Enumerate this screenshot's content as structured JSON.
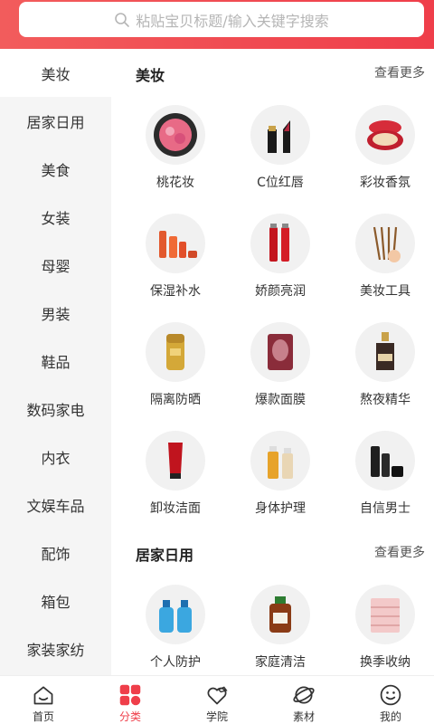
{
  "search": {
    "placeholder": "粘贴宝贝标题/输入关键字搜索"
  },
  "sidebar": {
    "items": [
      {
        "label": "美妆"
      },
      {
        "label": "居家日用"
      },
      {
        "label": "美食"
      },
      {
        "label": "女装"
      },
      {
        "label": "母婴"
      },
      {
        "label": "男装"
      },
      {
        "label": "鞋品"
      },
      {
        "label": "数码家电"
      },
      {
        "label": "内衣"
      },
      {
        "label": "文娱车品"
      },
      {
        "label": "配饰"
      },
      {
        "label": "箱包"
      },
      {
        "label": "家装家纺"
      }
    ]
  },
  "sections": [
    {
      "title": "美妆",
      "more": "查看更多",
      "items": [
        {
          "label": "桃花妆",
          "icon": "compact-powder-icon"
        },
        {
          "label": "C位红唇",
          "icon": "lipstick-icon"
        },
        {
          "label": "彩妆香氛",
          "icon": "cushion-compact-icon"
        },
        {
          "label": "保湿补水",
          "icon": "skincare-set-icon"
        },
        {
          "label": "娇颜亮润",
          "icon": "serum-bottles-icon"
        },
        {
          "label": "美妆工具",
          "icon": "makeup-brushes-icon"
        },
        {
          "label": "隔离防晒",
          "icon": "sunscreen-icon"
        },
        {
          "label": "爆款面膜",
          "icon": "face-mask-icon"
        },
        {
          "label": "熬夜精华",
          "icon": "essence-bottle-icon"
        },
        {
          "label": "卸妆洁面",
          "icon": "cleanser-tube-icon"
        },
        {
          "label": "身体护理",
          "icon": "body-care-icon"
        },
        {
          "label": "自信男士",
          "icon": "mens-care-icon"
        }
      ]
    },
    {
      "title": "居家日用",
      "more": "查看更多",
      "items": [
        {
          "label": "个人防护",
          "icon": "hand-sanitizer-icon"
        },
        {
          "label": "家庭清洁",
          "icon": "disinfectant-icon"
        },
        {
          "label": "换季收纳",
          "icon": "storage-drawer-icon"
        }
      ]
    }
  ],
  "tabbar": {
    "items": [
      {
        "label": "首页",
        "icon": "home-icon"
      },
      {
        "label": "分类",
        "icon": "category-icon"
      },
      {
        "label": "学院",
        "icon": "heart-hat-icon"
      },
      {
        "label": "素材",
        "icon": "planet-icon"
      },
      {
        "label": "我的",
        "icon": "smile-icon"
      }
    ]
  },
  "colors": {
    "accent": "#ef3e4a",
    "sidebar_bg": "#f5f5f5"
  }
}
